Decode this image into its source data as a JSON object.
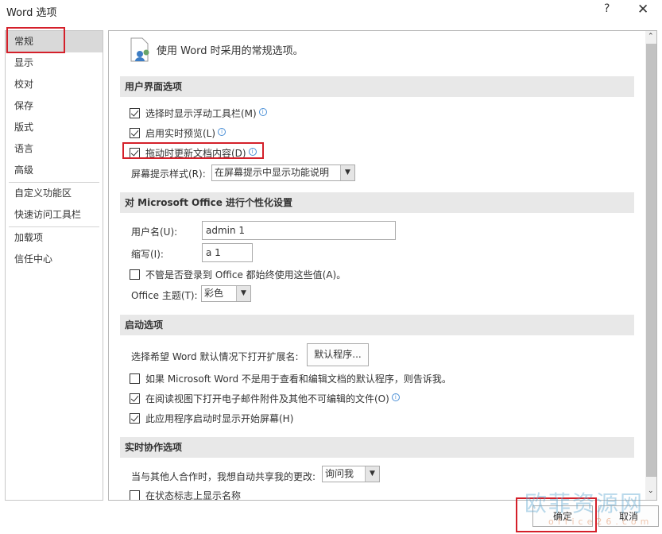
{
  "window": {
    "title": "Word 选项",
    "help": "?",
    "close": "✕"
  },
  "sidebar": {
    "items": [
      {
        "label": "常规"
      },
      {
        "label": "显示"
      },
      {
        "label": "校对"
      },
      {
        "label": "保存"
      },
      {
        "label": "版式"
      },
      {
        "label": "语言"
      },
      {
        "label": "高级"
      },
      {
        "label": "自定义功能区"
      },
      {
        "label": "快速访问工具栏"
      },
      {
        "label": "加载项"
      },
      {
        "label": "信任中心"
      }
    ]
  },
  "header": {
    "text": "使用 Word 时采用的常规选项。"
  },
  "ui_options": {
    "title": "用户界面选项",
    "mini_toolbar": {
      "label": "选择时显示浮动工具栏(M)",
      "checked": true
    },
    "live_preview": {
      "label": "启用实时预览(L)",
      "checked": true
    },
    "update_drag": {
      "label": "拖动时更新文档内容(D)",
      "checked": true
    },
    "screentip_label": "屏幕提示样式(R):",
    "screentip_value": "在屏幕提示中显示功能说明"
  },
  "personalize": {
    "title": "对 Microsoft Office 进行个性化设置",
    "username_label": "用户名(U):",
    "username": "admin 1",
    "initials_label": "缩写(I):",
    "initials": "a 1",
    "always_use": {
      "label": "不管是否登录到 Office 都始终使用这些值(A)。",
      "checked": false
    },
    "theme_label": "Office 主题(T):",
    "theme": "彩色"
  },
  "startup": {
    "title": "启动选项",
    "ext_label": "选择希望 Word 默认情况下打开扩展名:",
    "default_programs": "默认程序...",
    "tell_me": {
      "label": "如果 Microsoft Word 不是用于查看和编辑文档的默认程序，则告诉我。",
      "checked": false
    },
    "reading_view": {
      "label": "在阅读视图下打开电子邮件附件及其他不可编辑的文件(O)",
      "checked": true
    },
    "start_screen": {
      "label": "此应用程序启动时显示开始屏幕(H)",
      "checked": true
    }
  },
  "coauthor": {
    "title": "实时协作选项",
    "share_label": "当与其他人合作时，我想自动共享我的更改:",
    "share_value": "询问我",
    "show_names": {
      "label": "在状态标志上显示名称",
      "checked": false
    }
  },
  "footer": {
    "ok": "确定",
    "cancel": "取消"
  },
  "watermark": {
    "text": "欧菲资源网",
    "url": "office26.com"
  }
}
